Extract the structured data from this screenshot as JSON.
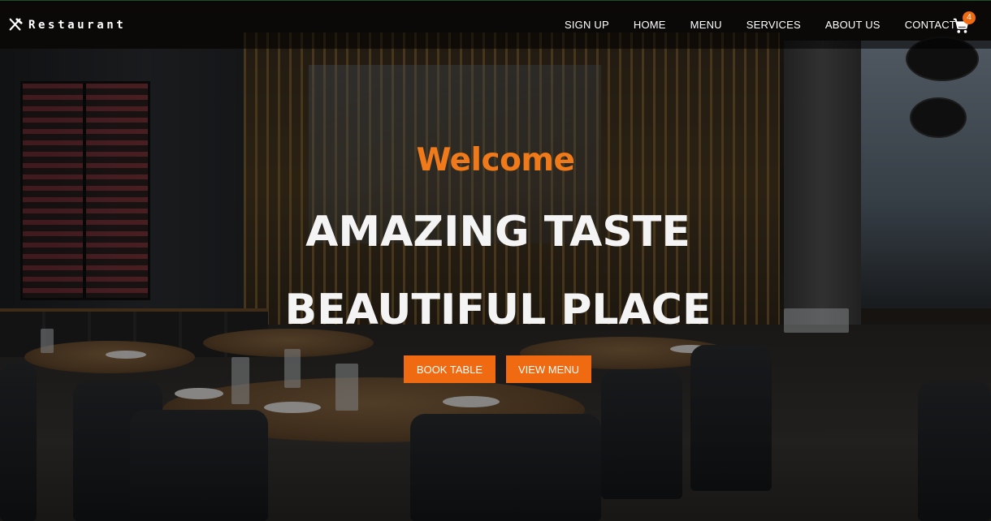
{
  "brand": {
    "name": "Restaurant",
    "icon": "fork-knife-icon"
  },
  "nav": {
    "links": [
      "SIGN UP",
      "HOME",
      "MENU",
      "SERVICES",
      "ABOUT US",
      "CONTACT"
    ],
    "cart_icon": "cart-icon",
    "cart_count": "4"
  },
  "hero": {
    "welcome": "Welcome",
    "line1": "AMAZING TASTE",
    "line2": "BEAUTIFUL PLACE",
    "book_button": "BOOK TABLE",
    "menu_button": "VIEW MENU"
  },
  "colors": {
    "accent": "#ef6a10",
    "text": "#ffffff",
    "nav_bg": "rgba(0,0,0,0.55)"
  }
}
